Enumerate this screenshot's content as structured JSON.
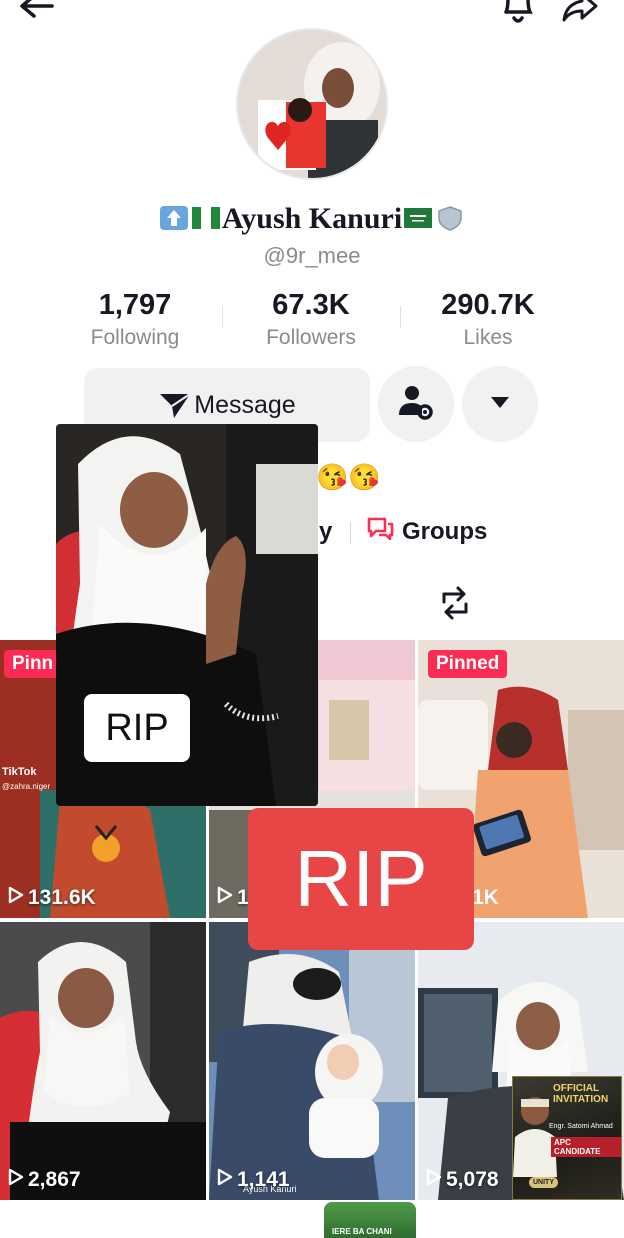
{
  "header": {
    "back_icon": "arrow-left-icon",
    "bell_icon": "bell-icon",
    "share_icon": "share-arrow-icon"
  },
  "profile": {
    "display_name": "Ayush Kanuri",
    "handle": "@9r_mee",
    "name_emojis": [
      "up-arrow-emoji",
      "nigeria-flag-emoji",
      "saudi-flag-emoji",
      "shield-emoji"
    ]
  },
  "stats": [
    {
      "value": "1,797",
      "label": "Following"
    },
    {
      "value": "67.3K",
      "label": "Followers"
    },
    {
      "value": "290.7K",
      "label": "Likes"
    }
  ],
  "actions": {
    "message_label": "Message",
    "add_friend_icon": "person-settings-icon",
    "more_icon": "caret-down-icon"
  },
  "bio": {
    "emojis": "😘😘",
    "partial_link": "y",
    "groups_label": "Groups"
  },
  "tabs": {
    "repost_icon": "repost-icon"
  },
  "overlays": {
    "rip_small": "RIP",
    "rip_big": "RIP"
  },
  "videos": [
    {
      "pinned": true,
      "pinned_label": "Pinn",
      "views": "131.6K",
      "watermark": "TikTok",
      "watermark_handle": "@zahra.niger"
    },
    {
      "pinned": false,
      "views": "1"
    },
    {
      "pinned": true,
      "pinned_label": "Pinned",
      "views": "1K"
    },
    {
      "pinned": false,
      "views": "2,867"
    },
    {
      "pinned": false,
      "views": "1,141",
      "caption": "Ayush Kanuri"
    },
    {
      "pinned": false,
      "views": "5,078"
    }
  ],
  "poster": {
    "title": "OFFICIAL INVITATION",
    "name": "Engr. Satomi Ahmad",
    "role": "APC CANDIDATE",
    "badge": "UNITY"
  },
  "bottom_thumb_text": "IERE BA CHANI",
  "colors": {
    "accent": "#fe2c55",
    "rip_red": "#e84646",
    "button_bg": "#f1f1f2",
    "muted_text": "#8a8b91"
  }
}
